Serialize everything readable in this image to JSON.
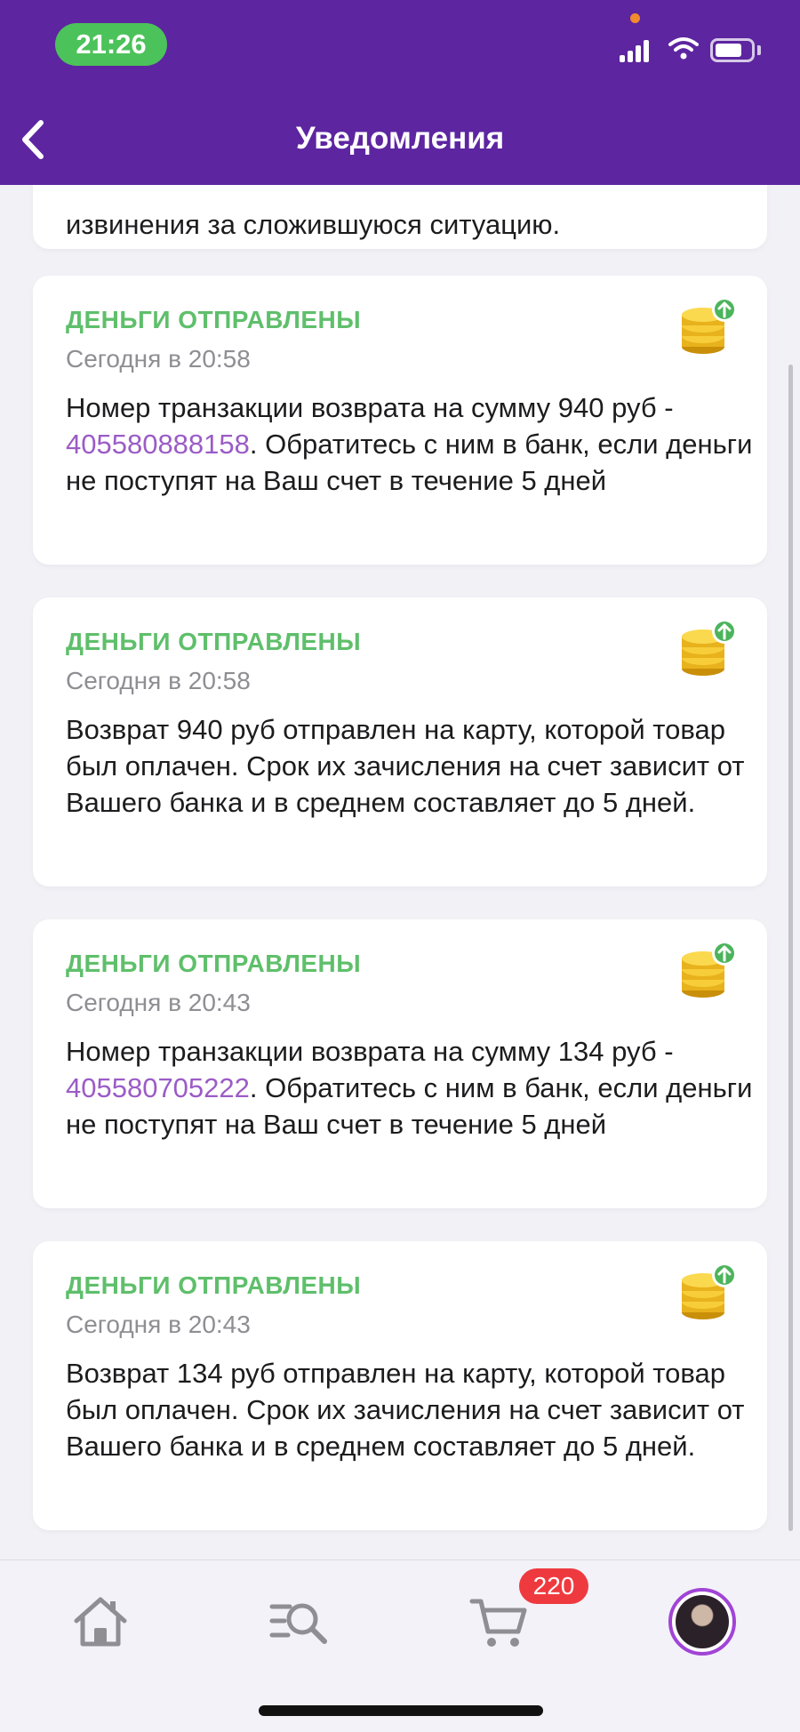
{
  "status_bar": {
    "time": "21:26"
  },
  "header": {
    "title": "Уведомления"
  },
  "partial_card": {
    "text": "извинения за сложившуюся ситуацию."
  },
  "notifications": [
    {
      "title": "ДЕНЬГИ ОТПРАВЛЕНЫ",
      "date": "Сегодня в 20:58",
      "text_before": "Номер транзакции возврата на сумму 940 руб - ",
      "link": "405580888158",
      "text_after": ". Обратитесь с ним в банк, если деньги не поступят на Ваш счет в течение 5 дней",
      "icon": "coins-icon"
    },
    {
      "title": "ДЕНЬГИ ОТПРАВЛЕНЫ",
      "date": "Сегодня в 20:58",
      "text_before": "Возврат 940 руб отправлен на карту, которой товар был оплачен. Срок их зачисления на счет зависит от Вашего банка и в среднем составляет до 5 дней.",
      "icon": "coins-icon"
    },
    {
      "title": "ДЕНЬГИ ОТПРАВЛЕНЫ",
      "date": "Сегодня в 20:43",
      "text_before": "Номер транзакции возврата на сумму 134 руб - ",
      "link": "405580705222",
      "text_after": ". Обратитесь с ним в банк, если деньги не поступят на Ваш счет в течение 5 дней",
      "icon": "coins-icon"
    },
    {
      "title": "ДЕНЬГИ ОТПРАВЛЕНЫ",
      "date": "Сегодня в 20:43",
      "text_before": "Возврат 134 руб отправлен на карту, которой товар был оплачен. Срок их зачисления на счет зависит от Вашего банка и в среднем составляет до 5 дней.",
      "icon": "coins-icon"
    }
  ],
  "tabbar": {
    "items": [
      "home-icon",
      "search-icon",
      "cart-icon",
      "profile-avatar"
    ],
    "cart_badge": "220"
  },
  "colors": {
    "header_bg": "#5d25a0",
    "title_green": "#5fbf6b",
    "link_purple": "#9b5cc6",
    "badge_red": "#ee3a3f",
    "time_pill": "#4cc25a"
  }
}
